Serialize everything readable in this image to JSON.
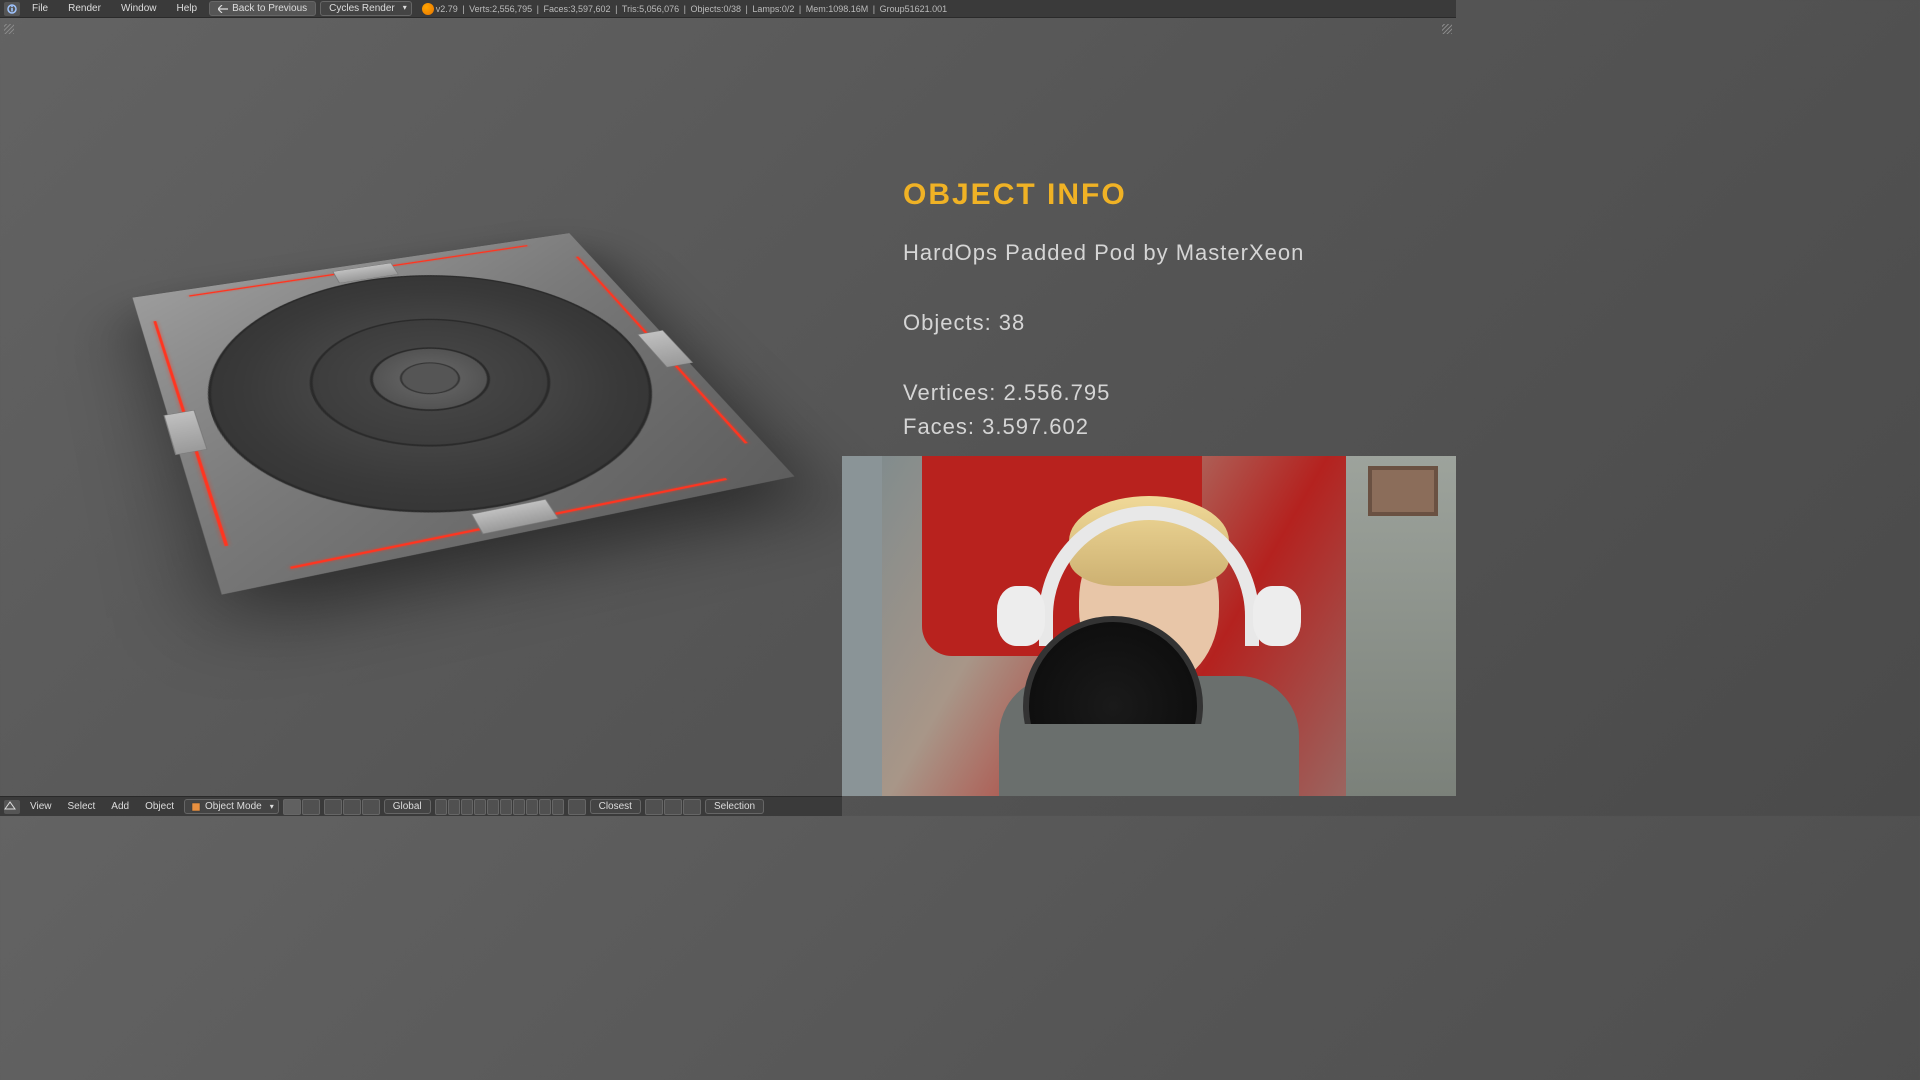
{
  "topbar": {
    "menus": {
      "file": "File",
      "render": "Render",
      "window": "Window",
      "help": "Help"
    },
    "back_button": "Back to Previous",
    "render_engine": "Cycles Render",
    "stats": {
      "version": "v2.79",
      "verts": "Verts:2,556,795",
      "faces": "Faces:3,597,602",
      "tris": "Tris:5,056,076",
      "objects": "Objects:0/38",
      "lamps": "Lamps:0/2",
      "mem": "Mem:1098.16M",
      "group": "Group51621.001"
    }
  },
  "bottombar": {
    "menus": {
      "view": "View",
      "select": "Select",
      "add": "Add",
      "object": "Object"
    },
    "mode": "Object Mode",
    "orientation": "Global",
    "snap": "Closest",
    "selection": "Selection"
  },
  "overlay": {
    "title": "OBJECT INFO",
    "subtitle": "HardOps Padded Pod by MasterXeon",
    "objects": "Objects: 38",
    "vertices": "Vertices: 2.556.795",
    "faces": "Faces: 3.597.602"
  }
}
